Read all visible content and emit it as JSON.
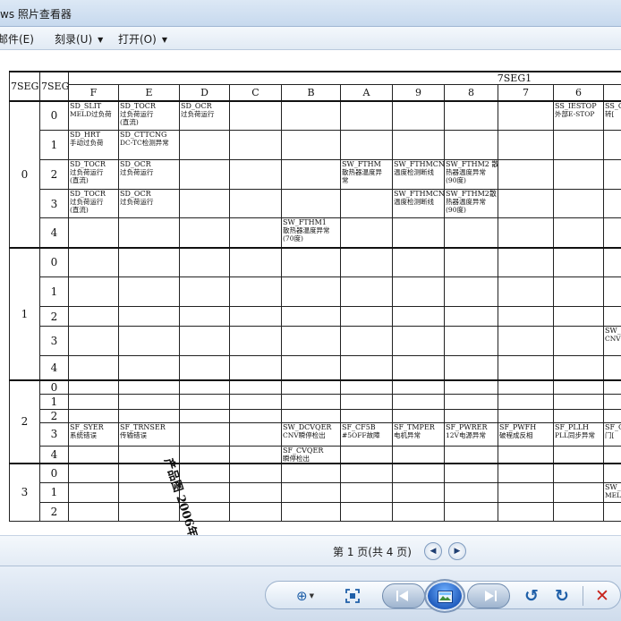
{
  "window": {
    "title": "ws 照片查看器"
  },
  "menu": {
    "items": [
      {
        "label": "邮件(E)",
        "has_dropdown": false
      },
      {
        "label": "刻录(U)",
        "has_dropdown": true
      },
      {
        "label": "打开(O)",
        "has_dropdown": true
      }
    ]
  },
  "document": {
    "header": {
      "seg3": "7SEG3",
      "seg2": "7SEG2",
      "seg1": "7SEG1",
      "columns": [
        "F",
        "E",
        "D",
        "C",
        "B",
        "A",
        "9",
        "8",
        "7",
        "6",
        ""
      ]
    },
    "groups": [
      {
        "seg3": "0",
        "rows": [
          {
            "seg2": "0",
            "cells": [
              {
                "code": "SD_SLIT",
                "desc": "MELD过负荷"
              },
              {
                "code": "SD_TOCR",
                "desc": "过负荷运行",
                "desc2": "(直流)"
              },
              {
                "code": "SD_OCR",
                "desc": "过负荷运行"
              },
              null,
              null,
              null,
              null,
              null,
              null,
              {
                "code": "SS_IESTOP",
                "desc": "外部E-STOP"
              },
              {
                "code": "SS_C",
                "desc": "转["
              }
            ]
          },
          {
            "seg2": "1",
            "cells": [
              {
                "code": "SD_HRT",
                "desc": "手动过负荷"
              },
              {
                "code": "SD_CTTCNG",
                "desc": "DC-TC检测异常"
              },
              null,
              null,
              null,
              null,
              null,
              null,
              null,
              null,
              null
            ]
          },
          {
            "seg2": "2",
            "cells": [
              {
                "code": "SD_TOCR",
                "desc": "过负荷运行",
                "desc2": "(直流)"
              },
              {
                "code": "SD_OCR",
                "desc": "过负荷运行"
              },
              null,
              null,
              null,
              {
                "code": "SW_FTHM",
                "desc": "散热器温度异",
                "desc2": "常"
              },
              {
                "code": "SW_FTHMCN",
                "desc": "温度检测断线"
              },
              {
                "code": "SW_FTHM2 散",
                "desc": "热器温度异常",
                "desc2": "(90度)"
              },
              null,
              null,
              null
            ]
          },
          {
            "seg2": "3",
            "cells": [
              {
                "code": "SD_TOCR",
                "desc": "过负荷运行",
                "desc2": "(直流)"
              },
              {
                "code": "SD_OCR",
                "desc": "过负荷运行"
              },
              null,
              null,
              null,
              null,
              {
                "code": "SW_FTHMCN",
                "desc": "温度检测断线"
              },
              {
                "code": "SW_FTHM2散",
                "desc": "热器温度异常",
                "desc2": "(90度)"
              },
              null,
              null,
              null
            ]
          },
          {
            "seg2": "4",
            "cells": [
              null,
              null,
              null,
              null,
              {
                "code": "SW_FTHM1",
                "desc": "散热器温度异常",
                "desc2": "(70度)"
              },
              null,
              null,
              null,
              null,
              null,
              null
            ]
          }
        ]
      },
      {
        "seg3": "1",
        "rows": [
          {
            "seg2": "0",
            "cells": [
              null,
              null,
              null,
              null,
              null,
              null,
              null,
              null,
              null,
              null,
              null
            ]
          },
          {
            "seg2": "1",
            "cells": [
              null,
              null,
              null,
              null,
              null,
              null,
              null,
              null,
              null,
              null,
              null
            ]
          },
          {
            "seg2": "2",
            "cells": [
              null,
              null,
              null,
              null,
              null,
              null,
              null,
              null,
              null,
              null,
              null
            ]
          },
          {
            "seg2": "3",
            "cells": [
              null,
              null,
              null,
              null,
              null,
              null,
              null,
              null,
              null,
              null,
              {
                "code": "SW_I",
                "desc": "CNV"
              }
            ]
          },
          {
            "seg2": "4",
            "cells": [
              null,
              null,
              null,
              null,
              null,
              null,
              null,
              null,
              null,
              null,
              null
            ]
          }
        ]
      },
      {
        "seg3": "2",
        "rows": [
          {
            "seg2": "0",
            "cells": [
              null,
              null,
              null,
              null,
              null,
              null,
              null,
              null,
              null,
              null,
              null
            ]
          },
          {
            "seg2": "1",
            "cells": [
              null,
              null,
              null,
              null,
              null,
              null,
              null,
              null,
              null,
              null,
              null
            ]
          },
          {
            "seg2": "2",
            "cells": [
              null,
              null,
              null,
              null,
              null,
              null,
              null,
              null,
              null,
              null,
              null
            ]
          },
          {
            "seg2": "3",
            "cells": [
              {
                "code": "SF_SYER",
                "desc": "系统错误"
              },
              {
                "code": "SF_TRNSER",
                "desc": "传输错误"
              },
              null,
              null,
              {
                "code": "SW_DCVQER",
                "desc": "CNV瞬停检出"
              },
              {
                "code": "SF_CF5B",
                "desc": "#5OFF故障"
              },
              {
                "code": "SF_TMPER",
                "desc": "电机异常"
              },
              {
                "code": "SF_PWRER",
                "desc": "12V电源异常"
              },
              {
                "code": "SF_PWFH",
                "desc": "破程成反相"
              },
              {
                "code": "SF_PLLH",
                "desc": "PLL同步异常"
              },
              {
                "code": "SF_G",
                "desc": "门["
              }
            ]
          },
          {
            "seg2": "4",
            "cells": [
              null,
              null,
              null,
              null,
              {
                "code": "SF_CVQER",
                "desc": "瞬停检出"
              },
              null,
              null,
              null,
              null,
              null,
              null
            ]
          }
        ]
      },
      {
        "seg3": "3",
        "rows": [
          {
            "seg2": "0",
            "cells": [
              null,
              null,
              null,
              null,
              null,
              null,
              null,
              null,
              null,
              null,
              null
            ]
          },
          {
            "seg2": "1",
            "cells": [
              null,
              null,
              null,
              null,
              null,
              null,
              null,
              null,
              null,
              null,
              {
                "code": "SW_",
                "desc": "MEL"
              }
            ]
          },
          {
            "seg2": "2",
            "cells": [
              null,
              null,
              null,
              null,
              null,
              null,
              null,
              null,
              null,
              null,
              null
            ]
          }
        ]
      }
    ],
    "stamp": "产品图 2006年"
  },
  "status": {
    "page_text": "第 1 页(共 4 页)"
  },
  "controls": {
    "icons": {
      "zoom": "zoom-icon",
      "fit": "actual-size-icon",
      "prev": "previous-icon",
      "slideshow": "slideshow-icon",
      "next": "next-icon",
      "rotate_ccw": "rotate-counterclockwise-icon",
      "rotate_cw": "rotate-clockwise-icon",
      "delete": "delete-icon"
    }
  },
  "colors": {
    "accent": "#1f5fa8",
    "delete": "#c8231c"
  }
}
